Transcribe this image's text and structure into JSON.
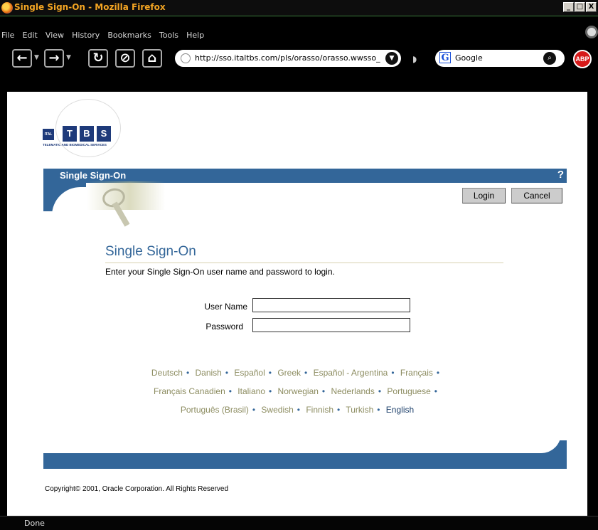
{
  "window": {
    "title": "Single Sign-On - Mozilla Firefox",
    "buttons": [
      "_",
      "□",
      "X"
    ]
  },
  "menu": [
    "File",
    "Edit",
    "View",
    "History",
    "Bookmarks",
    "Tools",
    "Help"
  ],
  "toolbar": {
    "url": "http://sso.italtbs.com/pls/orasso/orasso.wwsso_",
    "search_engine": "Google",
    "addon_label": "ABP",
    "icons": [
      "back-icon",
      "forward-icon",
      "reload-icon",
      "stop-icon",
      "home-icon",
      "go-icon",
      "feed-icon",
      "search-icon",
      "adblock-icon"
    ]
  },
  "logo": {
    "boxes": [
      "T",
      "B",
      "S"
    ],
    "small": "ITAL",
    "tagline": "TELEMATIC AND BIOMEDICAL SERVICES"
  },
  "banner": {
    "label": "Single Sign-On",
    "help": "?"
  },
  "actions": {
    "login": "Login",
    "cancel": "Cancel"
  },
  "form": {
    "title": "Single Sign-On",
    "instructions": "Enter your Single Sign-On user name and password to login.",
    "username_label": "User Name",
    "password_label": "Password",
    "username_value": "",
    "password_value": ""
  },
  "languages": {
    "rows": [
      [
        "Deutsch",
        "Danish",
        "Español",
        "Greek",
        "Español - Argentina",
        "Français"
      ],
      [
        "Français Canadien",
        "Italiano",
        "Norwegian",
        "Nederlands",
        "Portuguese"
      ],
      [
        "Português (Brasil)",
        "Swedish",
        "Finnish",
        "Turkish",
        "English"
      ]
    ],
    "current": "English"
  },
  "copyright": "Copyright© 2001, Oracle Corporation. All Rights Reserved",
  "status": "Done",
  "colors": {
    "brand_blue": "#336699",
    "lang_link": "#8c8c60",
    "title_amber": "#f5a623"
  }
}
